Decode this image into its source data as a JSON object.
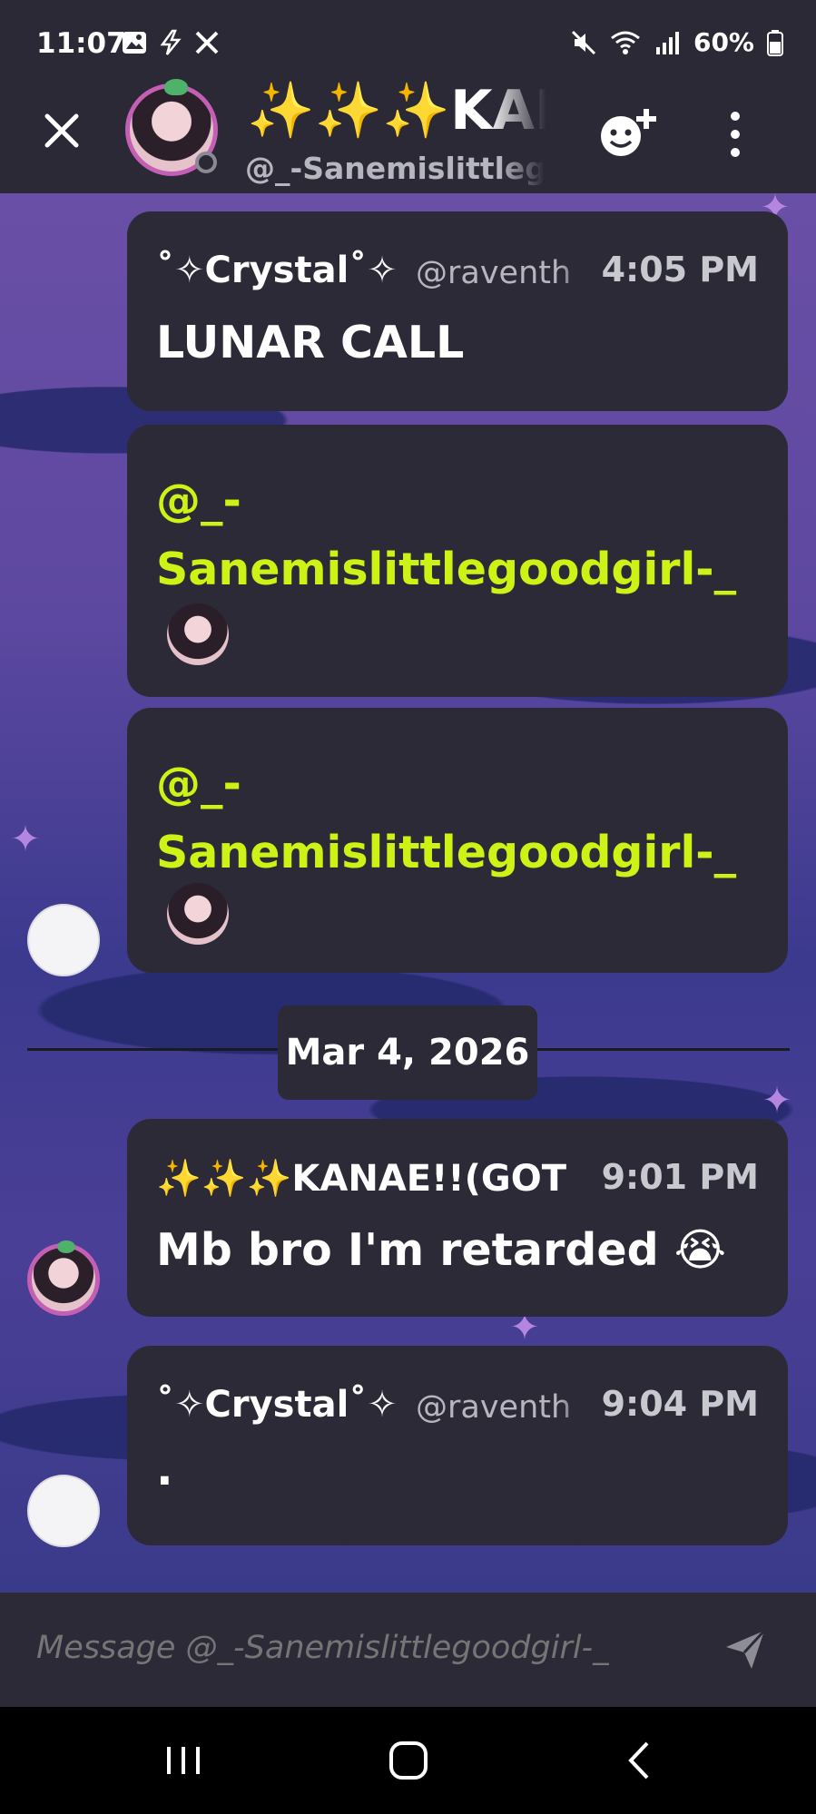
{
  "status_bar": {
    "time": "11:07",
    "battery": "60%",
    "left_icons": [
      "gallery-icon",
      "charging-bolt-icon",
      "x-logo-icon"
    ],
    "right_icons": [
      "mute-icon",
      "wifi-icon",
      "signal-icon",
      "battery-icon"
    ]
  },
  "header": {
    "title": "✨✨✨KANAE!!(GOT",
    "subtitle": "@_-Sanemislittlegoodgirl-_",
    "close_icon": "close-icon",
    "add_reaction_icon": "add-emoji-icon",
    "more_icon": "more-vertical-icon"
  },
  "messages": [
    {
      "name": "˚✧Crystal˚✧",
      "handle": "@raventh",
      "time": "4:05 PM",
      "text": "LUNAR CALL"
    },
    {
      "mention": "@_-Sanemislittlegoodgirl-_"
    },
    {
      "mention": "@_-Sanemislittlegoodgirl-_"
    }
  ],
  "date_divider": "Mar 4, 2026",
  "messages2": [
    {
      "name": "✨✨✨KANAE!!(GOT",
      "time": "9:01 PM",
      "text": "Mb bro I'm retarded 😭"
    },
    {
      "name": "˚✧Crystal˚✧",
      "handle": "@raventh",
      "time": "9:04 PM",
      "text": "."
    }
  ],
  "composer": {
    "placeholder": "Message @_-Sanemislittlegoodgirl-_",
    "send_icon": "send-icon"
  },
  "nav_bar": {
    "icons": [
      "recent-apps-icon",
      "home-icon",
      "back-icon"
    ]
  },
  "colors": {
    "bubble_bg": "#2b2a36",
    "mention": "#ccf216",
    "avatar_ring": "#c35fb4"
  }
}
